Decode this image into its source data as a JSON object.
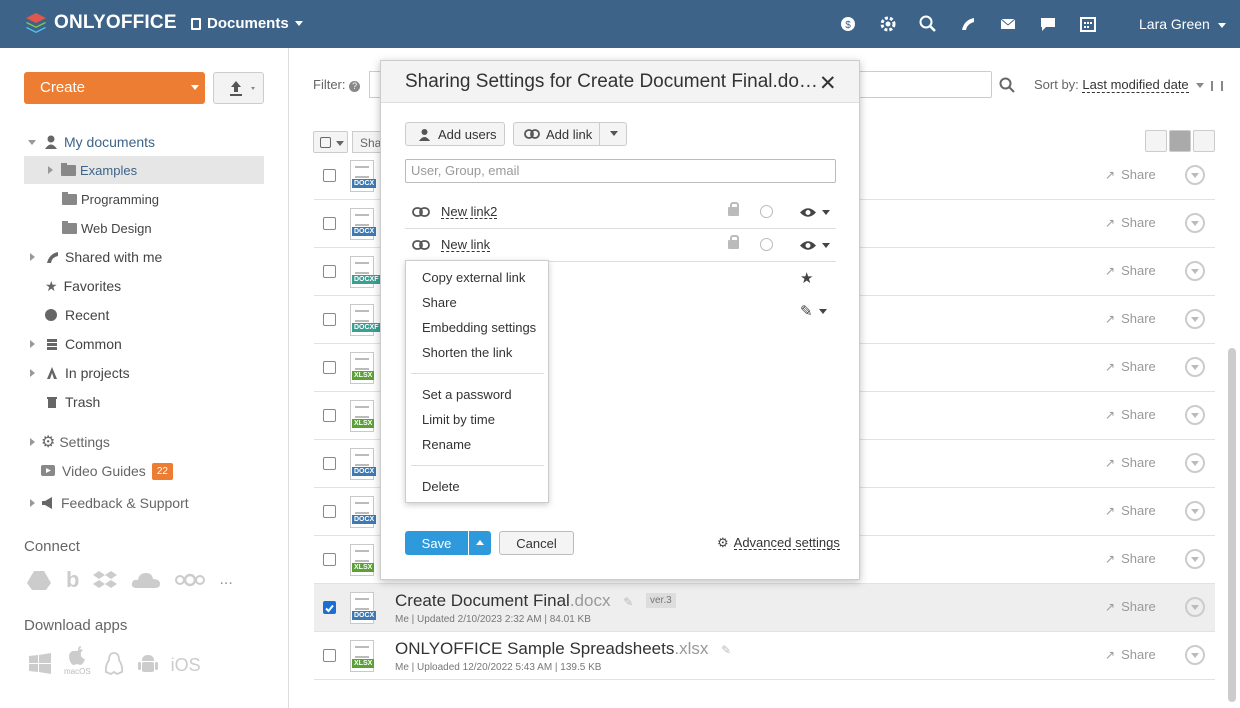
{
  "topbar": {
    "logo": "ONLYOFFICE",
    "module": "Documents",
    "user": "Lara Green",
    "icons": [
      "payments-icon",
      "settings-icon",
      "search-icon",
      "feed-icon",
      "mail-icon",
      "chat-icon",
      "calendar-icon"
    ]
  },
  "sidebar": {
    "create_label": "Create",
    "tree": {
      "my_documents": "My documents",
      "examples": "Examples",
      "programming": "Programming",
      "web_design": "Web Design",
      "shared": "Shared with me",
      "favorites": "Favorites",
      "recent": "Recent",
      "common": "Common",
      "projects": "In projects",
      "trash": "Trash"
    },
    "settings": "Settings",
    "video_guides": "Video Guides",
    "video_badge": "22",
    "feedback": "Feedback & Support",
    "connect": "Connect",
    "connect_more": "...",
    "download_apps": "Download apps",
    "ios": "iOS",
    "macos": "macOS"
  },
  "toolbar": {
    "filter": "Filter:",
    "sort_label": "Sort by:",
    "sort_value": "Last modified date",
    "share_partial": "Sha"
  },
  "rows": [
    {
      "ext": "DOCX",
      "color": "#3d7ab2"
    },
    {
      "ext": "DOCX",
      "color": "#3d7ab2"
    },
    {
      "ext": "DOCXF",
      "color": "#3a9f94"
    },
    {
      "ext": "DOCXF",
      "color": "#3a9f94"
    },
    {
      "ext": "XLSX",
      "color": "#5aa137"
    },
    {
      "ext": "XLSX",
      "color": "#5aa137"
    },
    {
      "ext": "DOCX",
      "color": "#3d7ab2"
    },
    {
      "ext": "DOCX",
      "color": "#3d7ab2"
    },
    {
      "ext": "XLSX",
      "color": "#5aa137"
    }
  ],
  "files": [
    {
      "name": "Create Document Final",
      "ext": ".docx",
      "version": "ver.3",
      "meta": "Me | Updated 2/10/2023 2:32 AM | 84.01 KB",
      "type": "DOCX"
    },
    {
      "name": "ONLYOFFICE Sample Spreadsheets",
      "ext": ".xlsx",
      "meta": "Me | Uploaded 12/20/2022 5:43 AM | 139.5 KB",
      "type": "XLSX"
    }
  ],
  "share_label": "Share",
  "modal": {
    "title": "Sharing Settings for Create Document Final.do…",
    "close": "✕",
    "add_users": "Add users",
    "add_link": "Add link",
    "placeholder": "User, Group, email",
    "link1": "New link2",
    "link2": "New link",
    "save": "Save",
    "cancel": "Cancel",
    "advanced": "Advanced settings"
  },
  "menu": {
    "copy": "Copy external link",
    "share": "Share",
    "embed": "Embedding settings",
    "shorten": "Shorten the link",
    "password": "Set a password",
    "limit": "Limit by time",
    "rename": "Rename",
    "delete": "Delete"
  }
}
